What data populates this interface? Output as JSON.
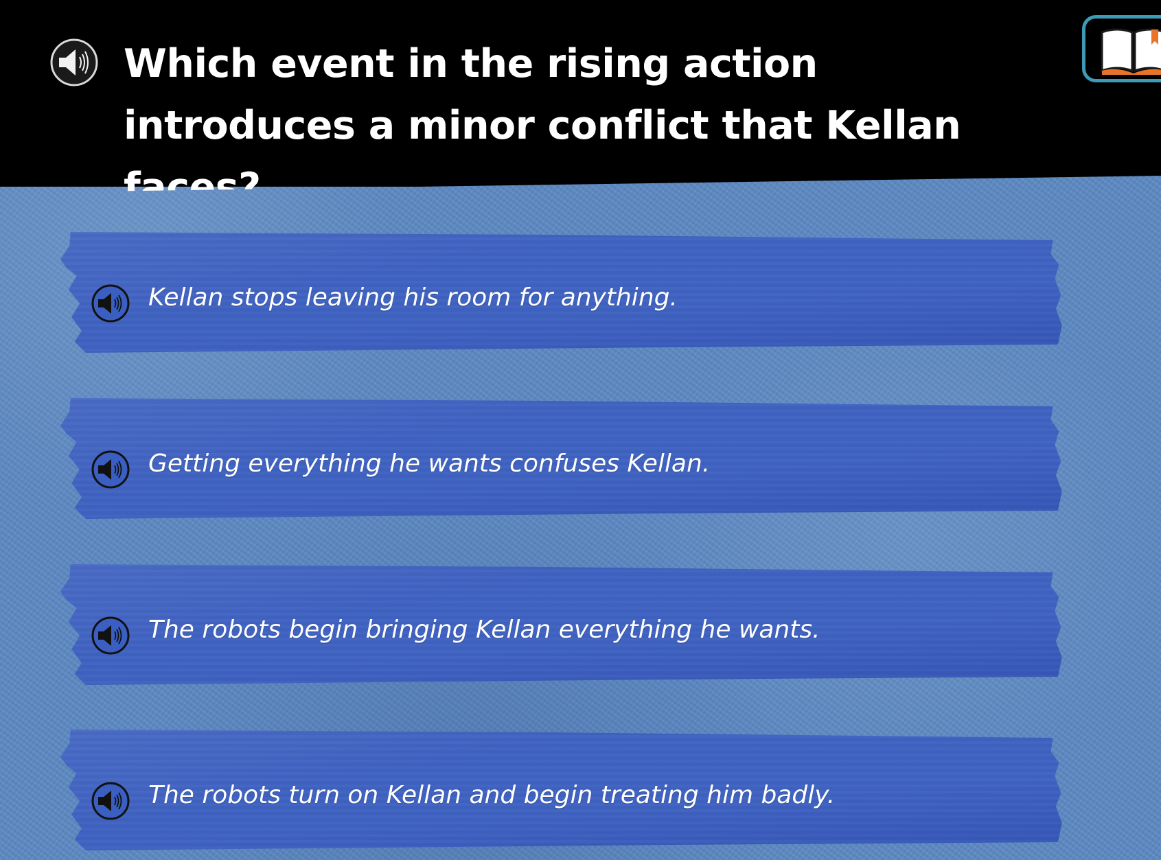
{
  "question": {
    "text": "Which event in the rising action introduces a minor conflict that Kellan faces?",
    "audio_icon": "speaker-icon"
  },
  "toolbar": {
    "book_icon": "open-book-icon"
  },
  "answers": [
    {
      "text": "Kellan stops leaving his room for anything.",
      "audio_icon": "speaker-icon"
    },
    {
      "text": "Getting everything he wants confuses Kellan.",
      "audio_icon": "speaker-icon"
    },
    {
      "text": "The robots begin bringing Kellan everything he wants.",
      "audio_icon": "speaker-icon"
    },
    {
      "text": "The robots turn on Kellan and begin treating him badly.",
      "audio_icon": "speaker-icon"
    }
  ],
  "colors": {
    "header_bg": "#000000",
    "page_bg": "#5d8ac4",
    "tape": "#3f62c2",
    "book_frame": "#3d9bb5",
    "book_bookmark": "#e8742a"
  }
}
